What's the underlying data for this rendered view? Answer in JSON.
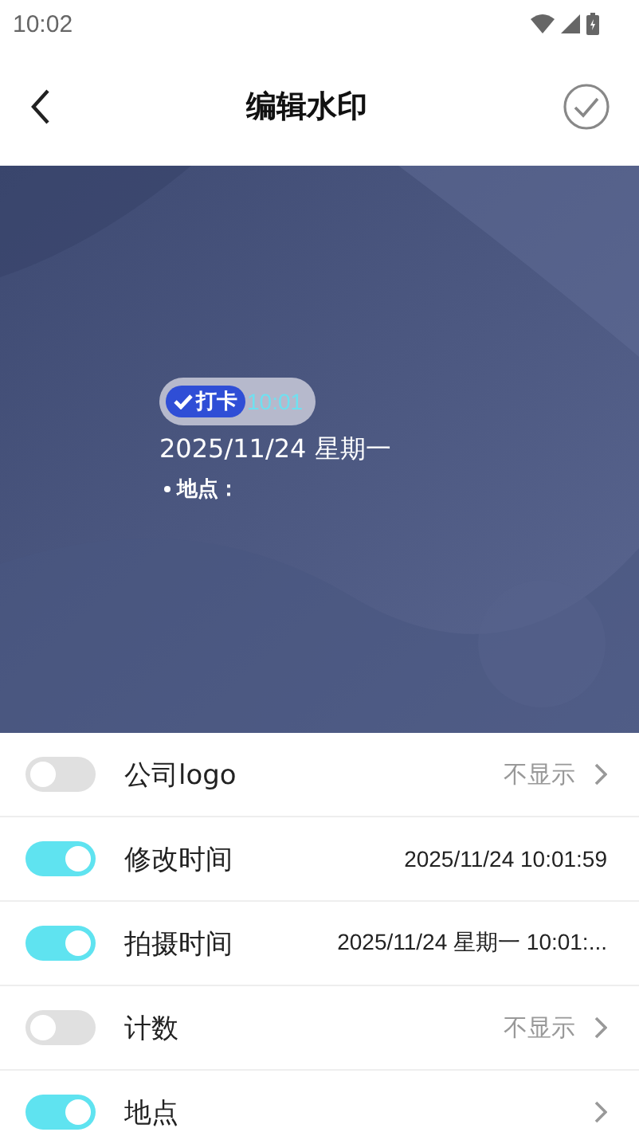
{
  "status_bar": {
    "time": "10:02"
  },
  "header": {
    "title": "编辑水印"
  },
  "preview": {
    "kind": "picture",
    "stamp": {
      "label": "打卡",
      "time": "10:01"
    },
    "date": "2025/11/24 星期一",
    "location": "地点："
  },
  "settings": [
    {
      "label": "公司logo",
      "on": false,
      "value": "不显示",
      "chevron": true
    },
    {
      "label": "修改时间",
      "on": true,
      "value": "2025/11/24 10:01:59",
      "chevron": false
    },
    {
      "label": "拍摄时间",
      "on": true,
      "value": "2025/11/24 星期一 10:01:...",
      "chevron": false
    },
    {
      "label": "计数",
      "on": false,
      "value": "不显示",
      "chevron": true
    },
    {
      "label": "地点",
      "on": true,
      "chevron": true
    }
  ]
}
